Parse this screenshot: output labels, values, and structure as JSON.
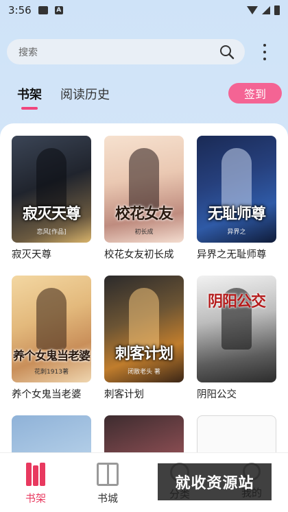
{
  "status_bar": {
    "time": "3:56",
    "notif_a": "A"
  },
  "search": {
    "placeholder": "搜索"
  },
  "tabs": [
    {
      "label": "书架",
      "active": true
    },
    {
      "label": "阅读历史",
      "active": false
    }
  ],
  "checkin_label": "签到",
  "books": [
    {
      "title": "寂灭天尊",
      "cover_title": "寂灭天尊",
      "cover_sub": "恋风[作品]"
    },
    {
      "title": "校花女友初长成",
      "cover_title": "校花女友",
      "cover_sub": "初长成"
    },
    {
      "title": "异界之无耻师尊",
      "cover_title": "无耻师尊",
      "cover_sub": "异界之"
    },
    {
      "title": "养个女鬼当老婆",
      "cover_title": "养个女鬼当老婆",
      "cover_sub": "花刺1913著"
    },
    {
      "title": "刺客计划",
      "cover_title": "刺客计划",
      "cover_sub": "闭散老头 著"
    },
    {
      "title": "阴阳公交",
      "cover_title": "阴阳公交",
      "cover_sub": ""
    }
  ],
  "bottom_nav": [
    {
      "label": "书架",
      "active": true
    },
    {
      "label": "书城",
      "active": false
    },
    {
      "label": "分类",
      "active": false
    },
    {
      "label": "我的",
      "active": false
    }
  ],
  "watermark": "就收资源站",
  "colors": {
    "accent": "#e8395f",
    "checkin": "#f46494",
    "bg_top": "#cfe3f8"
  }
}
